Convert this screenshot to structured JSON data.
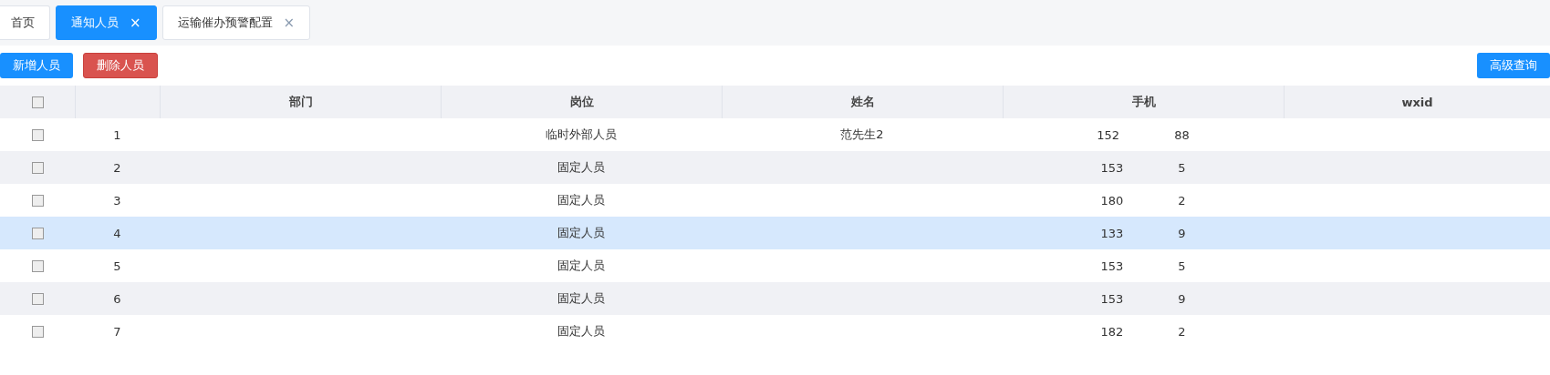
{
  "tabs": [
    {
      "label": "首页",
      "selected": false
    },
    {
      "label": "通知人员",
      "selected": true,
      "close": "×"
    },
    {
      "label": "运输催办预警配置",
      "selected": false,
      "close": "×"
    }
  ],
  "toolbar": {
    "left_buttons": [
      {
        "label": "新增人员",
        "kind": "primary"
      },
      {
        "label": "删除人员",
        "kind": "danger"
      }
    ],
    "right_buttons": [
      {
        "label": "高级查询",
        "kind": "primary"
      }
    ]
  },
  "table": {
    "select_all_checked": false,
    "columns": [
      "部门",
      "岗位",
      "姓名",
      "手机",
      "wxid"
    ],
    "rows": [
      {
        "index": "1",
        "checked": false,
        "highlighted": false,
        "position": "临时外部人员",
        "name": "范先生2",
        "phone_start": "152",
        "phone_end": "88"
      },
      {
        "index": "2",
        "checked": false,
        "highlighted": false,
        "position": "固定人员",
        "phone_start": "153",
        "phone_end": "5"
      },
      {
        "index": "3",
        "checked": false,
        "highlighted": false,
        "position": "固定人员",
        "phone_start": "180",
        "phone_end": "2"
      },
      {
        "index": "4",
        "checked": false,
        "highlighted": true,
        "position": "固定人员",
        "phone_start": "133",
        "phone_end": "9"
      },
      {
        "index": "5",
        "checked": false,
        "highlighted": false,
        "position": "固定人员",
        "phone_start": "153",
        "phone_end": "5"
      },
      {
        "index": "6",
        "checked": false,
        "highlighted": false,
        "position": "固定人员",
        "phone_start": "153",
        "phone_end": "9"
      },
      {
        "index": "7",
        "checked": false,
        "highlighted": false,
        "position": "固定人员",
        "phone_start": "182",
        "phone_end": "2"
      }
    ]
  }
}
